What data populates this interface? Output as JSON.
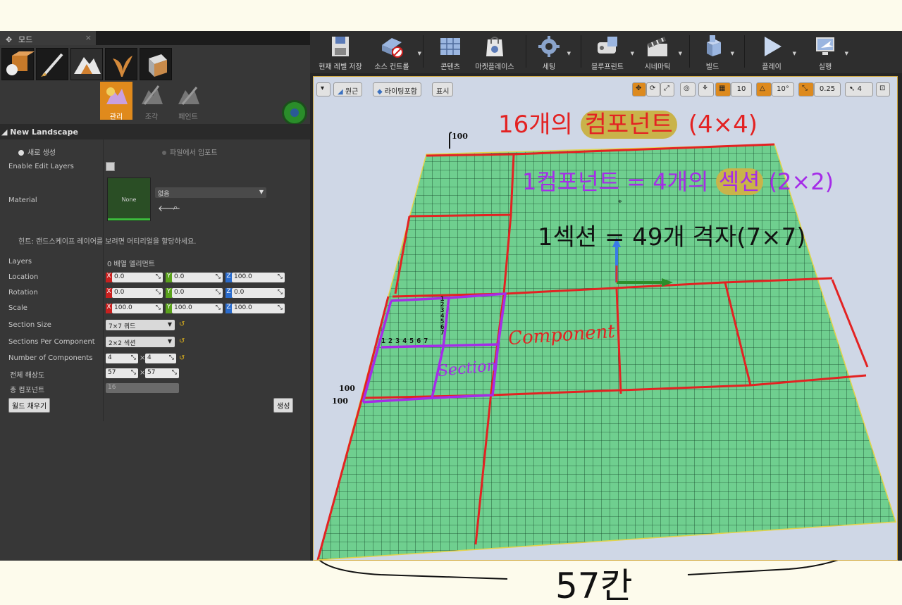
{
  "panel": {
    "tab_title": "모드",
    "tools": [
      "관리",
      "조각",
      "페인트"
    ],
    "section_title": "New Landscape",
    "radio_new": "새로 생성",
    "radio_import": "파일에서 임포트",
    "enable_edit_layers": "Enable Edit Layers",
    "material_label": "Material",
    "material_thumb": "None",
    "material_value": "없음",
    "hint": "힌트: 랜드스케이프 레이어를 보려면 머티리얼을 할당하세요.",
    "layers_label": "Layers",
    "layers_value": "0 배열 엘리먼트",
    "location_label": "Location",
    "location": {
      "x": "0.0",
      "y": "0.0",
      "z": "100.0"
    },
    "rotation_label": "Rotation",
    "rotation": {
      "x": "0.0",
      "y": "0.0",
      "z": "0.0"
    },
    "scale_label": "Scale",
    "scale": {
      "x": "100.0",
      "y": "100.0",
      "z": "100.0"
    },
    "section_size_label": "Section Size",
    "section_size_value": "7×7 쿼드",
    "sections_per_label": "Sections Per Component",
    "sections_per_value": "2×2 섹션",
    "num_components_label": "Number of Components",
    "num_components": {
      "x": "4",
      "y": "4",
      "sep": "×"
    },
    "resolution_label": "전체 해상도",
    "resolution": {
      "x": "57",
      "y": "57",
      "sep": "×"
    },
    "total_components_label": "총 컴포넌트",
    "total_components_value": "16",
    "fill_world_button": "월드 채우기",
    "create_button": "생성"
  },
  "toolbar": {
    "items": [
      "현재 레벨 저장",
      "소스 컨트롤",
      "콘텐츠",
      "마켓플레이스",
      "세팅",
      "블루프린트",
      "시네마틱",
      "빌드",
      "플레이",
      "실행"
    ]
  },
  "viewport": {
    "perspective": "원근",
    "lighting": "라이팅포함",
    "show": "표시",
    "grid_snap": "10",
    "rot_snap": "10°",
    "scale_snap": "0.25",
    "cam_speed": "4"
  },
  "annotations": {
    "title_prefix": "16개의 ",
    "title_highlight": "컴포넌트",
    "title_suffix": "(4×4)",
    "line2_prefix": "1컴포넌트 = 4개의 ",
    "line2_highlight": "섹션",
    "line2_suffix": "(2×2)",
    "line3": "1섹션 = 49개 격자(7×7)",
    "component_label": "Component",
    "section_label": "Section",
    "count_row": "1 2 3 4 5 6 7",
    "count_col": "1 2 3 4 5 6 7",
    "marker_100_top": "100",
    "marker_100_a": "100",
    "marker_100_b": "100",
    "bottom_label": "57칸"
  }
}
